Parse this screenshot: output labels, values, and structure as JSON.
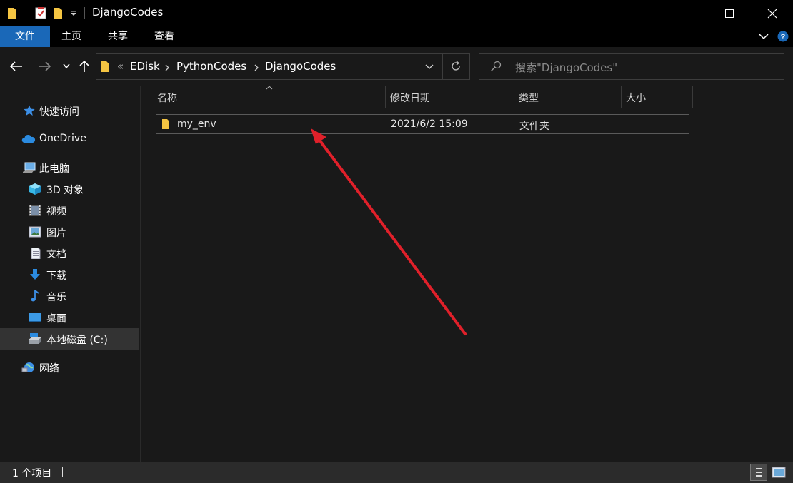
{
  "window": {
    "title": "DjangoCodes"
  },
  "ribbon": {
    "tabs": [
      "文件",
      "主页",
      "共享",
      "查看"
    ]
  },
  "address": {
    "overflow": "«",
    "crumbs": [
      "EDisk",
      "PythonCodes",
      "DjangoCodes"
    ]
  },
  "search": {
    "placeholder": "搜索\"DjangoCodes\""
  },
  "sidebar": {
    "items": [
      {
        "label": "快速访问",
        "icon": "star-icon"
      },
      {
        "label": "OneDrive",
        "icon": "cloud-icon"
      },
      {
        "label": "此电脑",
        "icon": "computer-icon"
      },
      {
        "label": "3D 对象",
        "icon": "cube-icon"
      },
      {
        "label": "视频",
        "icon": "video-icon"
      },
      {
        "label": "图片",
        "icon": "picture-icon"
      },
      {
        "label": "文档",
        "icon": "document-icon"
      },
      {
        "label": "下载",
        "icon": "download-icon"
      },
      {
        "label": "音乐",
        "icon": "music-icon"
      },
      {
        "label": "桌面",
        "icon": "desktop-icon"
      },
      {
        "label": "本地磁盘 (C:)",
        "icon": "drive-icon"
      },
      {
        "label": "网络",
        "icon": "network-icon"
      }
    ]
  },
  "columns": {
    "name": "名称",
    "modified": "修改日期",
    "type": "类型",
    "size": "大小"
  },
  "files": [
    {
      "name": "my_env",
      "modified": "2021/6/2 15:09",
      "type": "文件夹",
      "size": ""
    }
  ],
  "status": {
    "count": "1 个项目"
  },
  "colors": {
    "accent": "#1a68b8",
    "folder": "#f5c542",
    "arrow": "#e0202a"
  }
}
